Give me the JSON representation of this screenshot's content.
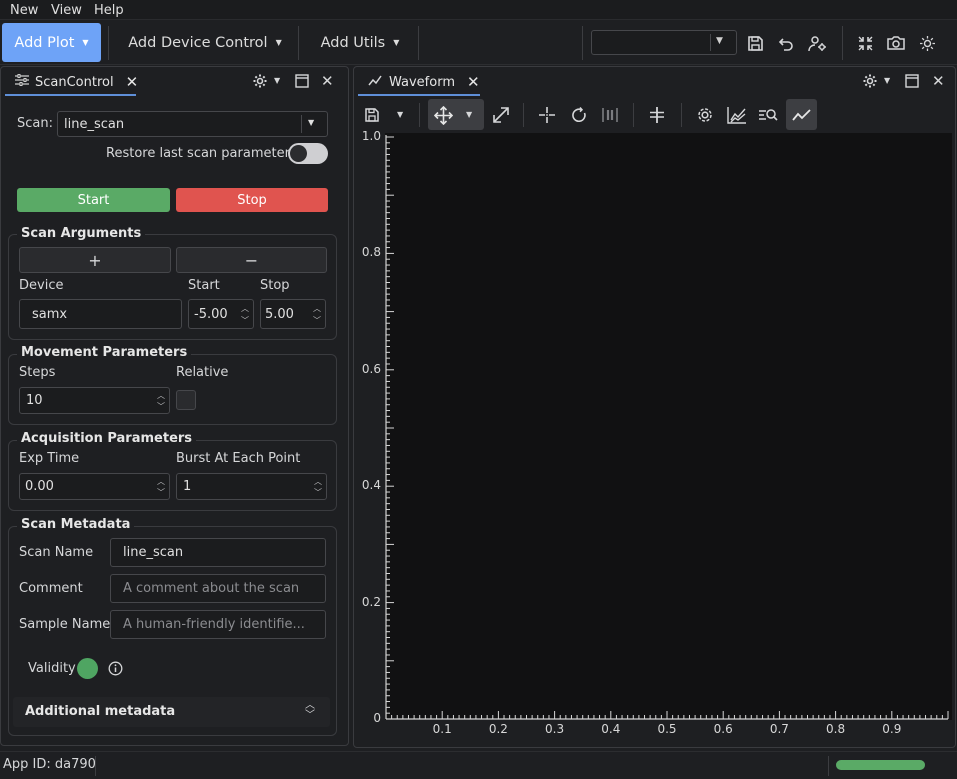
{
  "menu": {
    "items": [
      "New",
      "View",
      "Help"
    ]
  },
  "toolbar": {
    "add_plot": "Add Plot",
    "add_device_control": "Add Device Control",
    "add_utils": "Add Utils",
    "combo_value": ""
  },
  "left_dock": {
    "tab_title": "ScanControl",
    "scan_label": "Scan:",
    "scan_value": "line_scan",
    "restore_label": "Restore last scan parameters",
    "restore_on": false,
    "start_label": "Start",
    "stop_label": "Stop",
    "scan_arguments": {
      "title": "Scan Arguments",
      "add_symbol": "+",
      "remove_symbol": "−",
      "device_header": "Device",
      "start_header": "Start",
      "stop_header": "Stop",
      "device_value": "samx",
      "start_value": "-5.00",
      "stop_value": "5.00"
    },
    "movement": {
      "title": "Movement Parameters",
      "steps_label": "Steps",
      "steps_value": "10",
      "relative_label": "Relative",
      "relative_checked": false
    },
    "acquisition": {
      "title": "Acquisition Parameters",
      "exp_time_label": "Exp Time",
      "exp_time_value": "0.00",
      "burst_label": "Burst At Each Point",
      "burst_value": "1"
    },
    "metadata": {
      "title": "Scan Metadata",
      "scan_name_label": "Scan Name",
      "scan_name_value": "line_scan",
      "comment_label": "Comment",
      "comment_placeholder": "A comment about the scan",
      "sample_name_label": "Sample Name",
      "sample_name_placeholder": "A human-friendly identifie...",
      "validity_label": "Validity",
      "additional_label": "Additional metadata"
    }
  },
  "right_dock": {
    "tab_title": "Waveform"
  },
  "chart_data": {
    "type": "line",
    "title": "",
    "xlabel": "",
    "ylabel": "",
    "xlim": [
      0,
      1
    ],
    "ylim": [
      0,
      1
    ],
    "x_ticks": [
      "0.1",
      "0.2",
      "0.3",
      "0.4",
      "0.5",
      "0.6",
      "0.7",
      "0.8",
      "0.9"
    ],
    "y_ticks": [
      "0",
      "0.2",
      "0.4",
      "0.6",
      "0.8",
      "1.0"
    ],
    "series": []
  },
  "status": {
    "app_id": "App ID: da790",
    "progress": 1.0
  },
  "colors": {
    "accent": "#6ea3f7",
    "start": "#5aaa66",
    "stop": "#e0544f",
    "validity": "#4fa562",
    "progress": "#5aaa66"
  }
}
